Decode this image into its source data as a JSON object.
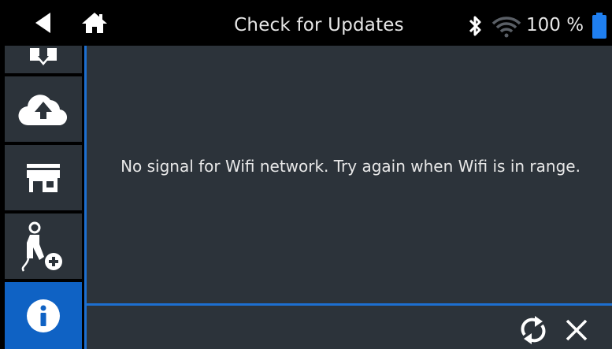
{
  "header": {
    "title": "Check for Updates",
    "battery_percent": "100 %",
    "back_icon": "back-arrow-icon",
    "home_icon": "home-icon",
    "bluetooth_icon": "bluetooth-icon",
    "wifi_icon": "wifi-icon",
    "battery_icon": "battery-icon"
  },
  "sidebar": {
    "items": [
      {
        "icon": "download-icon",
        "active": false
      },
      {
        "icon": "cloud-upload-icon",
        "active": false
      },
      {
        "icon": "shop-icon",
        "active": false
      },
      {
        "icon": "add-tester-icon",
        "active": false
      },
      {
        "icon": "info-icon",
        "active": true
      }
    ]
  },
  "main": {
    "message": "No signal for Wifi network. Try again when Wifi is in range."
  },
  "footer": {
    "refresh_icon": "refresh-icon",
    "close_icon": "close-icon"
  },
  "colors": {
    "accent": "#1d6fd0",
    "active_item": "#0f62c4",
    "panel": "#2c333a",
    "background": "#000000"
  }
}
